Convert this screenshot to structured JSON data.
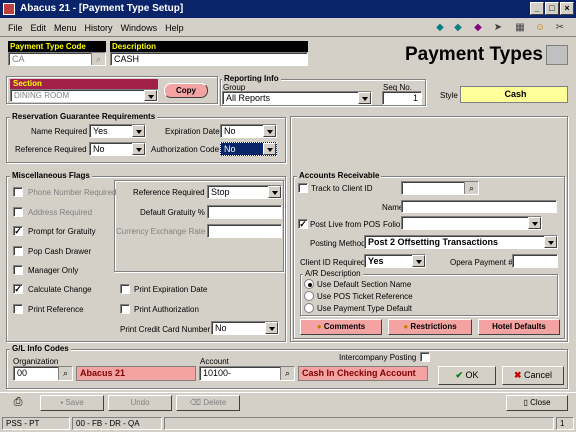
{
  "window": {
    "title": "Abacus 21 - [Payment Type Setup]"
  },
  "menu": [
    "File",
    "Edit",
    "Menu",
    "History",
    "Windows",
    "Help"
  ],
  "header": {
    "payment_type_code_label": "Payment Type Code",
    "payment_type_code_value": "CA",
    "description_label": "Description",
    "description_value": "CASH",
    "page_title": "Payment Types"
  },
  "section": {
    "label": "Section",
    "value": "DINING ROOM",
    "copy_label": "Copy"
  },
  "reporting_info": {
    "label": "Reporting Info",
    "group_label": "Group",
    "group_value": "All Reports",
    "seq_label": "Seq No.",
    "seq_value": "1",
    "style_label": "Style",
    "style_value": "Cash"
  },
  "reservation": {
    "title": "Reservation Guarantee Requirements",
    "name_required_label": "Name Required",
    "name_required_value": "Yes",
    "reference_required_label": "Reference Required",
    "reference_required_value": "No",
    "expiration_date_label": "Expiration Date",
    "expiration_date_value": "No",
    "authorization_code_label": "Authorization Code",
    "authorization_code_value": "No"
  },
  "misc_flags": {
    "title": "Miscellaneous Flags",
    "phone_number_required": "Phone Number Required",
    "address_required": "Address Required",
    "prompt_for_gratuity": "Prompt for Gratuity",
    "pop_cash_drawer": "Pop Cash Drawer",
    "manager_only": "Manager Only",
    "calculate_change": "Calculate Change",
    "print_reference": "Print Reference",
    "print_expiration_date": "Print Expiration Date",
    "print_authorization": "Print Authorization",
    "print_credit_card_number_label": "Print Credit Card Number",
    "print_credit_card_number_value": "No",
    "reference_required_label": "Reference Required",
    "reference_required_value": "Stop",
    "default_gratuity_label": "Default Gratuity %",
    "default_gratuity_value": "",
    "currency_exchange_rate_label": "Currency Exchange Rate",
    "currency_exchange_rate_value": ""
  },
  "accounts_receivable": {
    "title": "Accounts Receivable",
    "track_to_client_id": "Track to Client ID",
    "name_label": "Name",
    "post_live_from_pos": "Post Live from POS",
    "folio_label": "Folio",
    "posting_method_label": "Posting Method",
    "posting_method_value": "Post 2 Offsetting Transactions",
    "client_id_required_label": "Client ID Required",
    "client_id_required_value": "Yes",
    "opera_payment_label": "Opera Payment #",
    "ar_description_title": "A/R Description",
    "radio_default_section": "Use Default Section Name",
    "radio_pos_ticket": "Use POS Ticket Reference",
    "radio_payment_type_default": "Use Payment Type Default",
    "comments_label": "Comments",
    "restrictions_label": "Restrictions",
    "hotel_defaults_label": "Hotel Defaults"
  },
  "gl_info": {
    "title": "G/L Info Codes",
    "organization_label": "Organization",
    "organization_code": "00",
    "organization_name": "Abacus 21",
    "account_label": "Account",
    "account_code": "10100-",
    "account_name": "Cash In Checking Account",
    "intercompany_label": "Intercompany Posting"
  },
  "buttons": {
    "ok": "OK",
    "cancel": "Cancel",
    "save": "Save",
    "undo": "Undo",
    "delete": "Delete",
    "close": "Close"
  },
  "status": {
    "left": "PSS - PT",
    "middle": "00 - FB - DR - QA",
    "right": "1"
  },
  "colors": {
    "title_bg": "#0a246a",
    "pink": "#f4a3a3",
    "highlight_yellow": "#ffff99",
    "section_header": "#a0204a",
    "black_header": "#000000"
  }
}
